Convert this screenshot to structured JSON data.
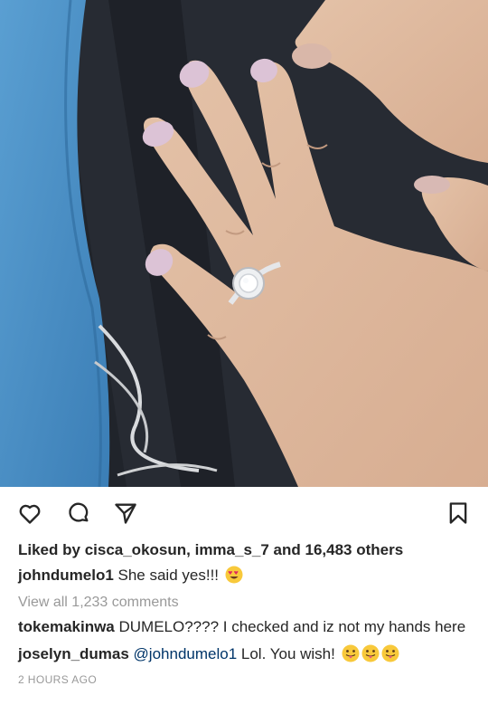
{
  "post": {
    "image_alt": "Hand with engagement ring",
    "likes_prefix": "Liked by ",
    "liker_1": "cisca_okosun",
    "liker_sep": ", ",
    "liker_2": "imma_s_7",
    "likes_and": " and ",
    "likes_others": "16,483 others",
    "caption_user": "johndumelo1",
    "caption_text": " She said yes!!! ",
    "view_all": "View all 1,233 comments",
    "comments": [
      {
        "user": "tokemakinwa",
        "text": " DUMELO???? I checked and iz not my hands here"
      },
      {
        "user": "joselyn_dumas",
        "mention": " @johndumelo1",
        "text": " Lol. You wish! "
      }
    ],
    "timestamp": "2 HOURS AGO"
  },
  "icons": {
    "like": "heart-icon",
    "comment": "comment-icon",
    "share": "share-icon",
    "save": "bookmark-icon",
    "heart_eyes": "heart-eyes-emoji",
    "tongue": "tongue-out-emoji"
  },
  "colors": {
    "text": "#262626",
    "muted": "#999999",
    "mention": "#003569"
  }
}
